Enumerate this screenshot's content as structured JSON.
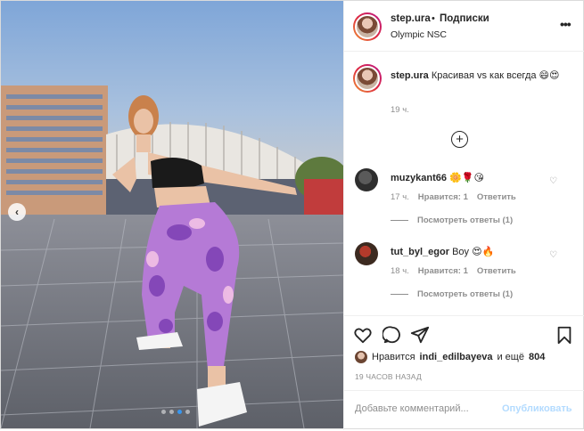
{
  "post": {
    "username": "step.ura",
    "separator": "•",
    "follow_label": "Подписки",
    "location": "Olympic NSC",
    "more_icon": "more-horizontal-icon",
    "carousel_dots": 4,
    "active_dot": 3
  },
  "caption": {
    "username": "step.ura",
    "text": "Красивая vs как всегда 😄😍",
    "time": "19 ч."
  },
  "comments": [
    {
      "username": "muzykant66",
      "text": "🌼🌹😘",
      "time": "17 ч.",
      "likes_label": "Нравится: 1",
      "reply_label": "Ответить",
      "view_replies": "Посмотреть ответы (1)"
    },
    {
      "username": "tut_byl_egor",
      "text": "Boy 😍🔥",
      "time": "18 ч.",
      "likes_label": "Нравится: 1",
      "reply_label": "Ответить",
      "view_replies": "Посмотреть ответы (1)"
    }
  ],
  "actions": {
    "likes_prefix": "Нравится",
    "liked_by": "indi_edilbayeva",
    "likes_suffix": "и ещё",
    "likes_count": "804",
    "time_ago": "19 ЧАСОВ НАЗАД",
    "comment_placeholder": "Добавьте комментарий...",
    "publish_label": "Опубликовать"
  }
}
